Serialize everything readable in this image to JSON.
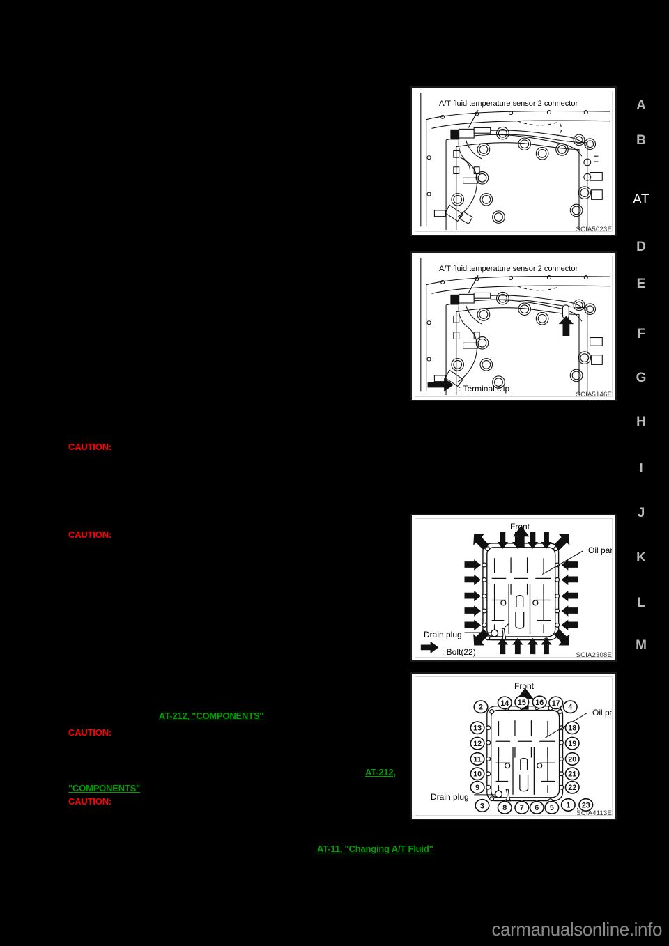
{
  "page": {
    "section_code": "AT",
    "watermark": "carmanualsonline.info",
    "background": "#000000",
    "link_color": "#00a000",
    "caution_color": "#ff0000"
  },
  "section_tabs": [
    {
      "label": "A",
      "current": false
    },
    {
      "label": "B",
      "current": false
    },
    {
      "label": "AT",
      "current": true
    },
    {
      "label": "D",
      "current": false
    },
    {
      "label": "E",
      "current": false
    },
    {
      "label": "F",
      "current": false
    },
    {
      "label": "G",
      "current": false
    },
    {
      "label": "H",
      "current": false
    },
    {
      "label": "I",
      "current": false
    },
    {
      "label": "J",
      "current": false
    },
    {
      "label": "K",
      "current": false
    },
    {
      "label": "L",
      "current": false
    },
    {
      "label": "M",
      "current": false
    }
  ],
  "figures": [
    {
      "id": "fig-sensor-connector",
      "code": "SCIA5023E",
      "callout": "A/T fluid temperature sensor 2 connector",
      "legend": ""
    },
    {
      "id": "fig-sensor-connector-clip",
      "code": "SCIA5146E",
      "callout": "A/T fluid temperature sensor 2 connector",
      "legend": ": Terminal clip"
    },
    {
      "id": "fig-oil-pan-bolts",
      "code": "SCIA2308E",
      "front_label": "Front",
      "oil_pan_label": "Oil pan",
      "drain_plug_label": "Drain plug",
      "legend": ": Bolt(22)"
    },
    {
      "id": "fig-oil-pan-sequence",
      "code": "SCIA4113E",
      "front_label": "Front",
      "oil_pan_label": "Oil pan",
      "drain_plug_label": "Drain plug",
      "bolt_sequence_top": [
        "14",
        "15",
        "16",
        "17"
      ],
      "bolt_sequence_left": [
        "2",
        "13",
        "12",
        "11",
        "10",
        "9",
        "3"
      ],
      "bolt_sequence_right": [
        "4",
        "18",
        "19",
        "20",
        "21",
        "22"
      ],
      "bolt_sequence_bottom": [
        "8",
        "7",
        "6",
        "5"
      ],
      "bolt_sequence_corner": "1",
      "bolt_sequence_last": "23",
      "corner_separator": ","
    }
  ],
  "cautions": [
    {
      "id": "caution-1",
      "label": "CAUTION:"
    },
    {
      "id": "caution-2",
      "label": "CAUTION:"
    },
    {
      "id": "caution-3",
      "label": "CAUTION:"
    },
    {
      "id": "caution-4",
      "label": "CAUTION:"
    }
  ],
  "links": [
    {
      "id": "link-at212-components",
      "label": "AT-212, \"COMPONENTS\""
    },
    {
      "id": "link-at212",
      "label": "AT-212,"
    },
    {
      "id": "link-components",
      "label": "\"COMPONENTS\""
    },
    {
      "id": "link-at11-changing",
      "label": "AT-11, \"Changing A/T Fluid\""
    }
  ]
}
